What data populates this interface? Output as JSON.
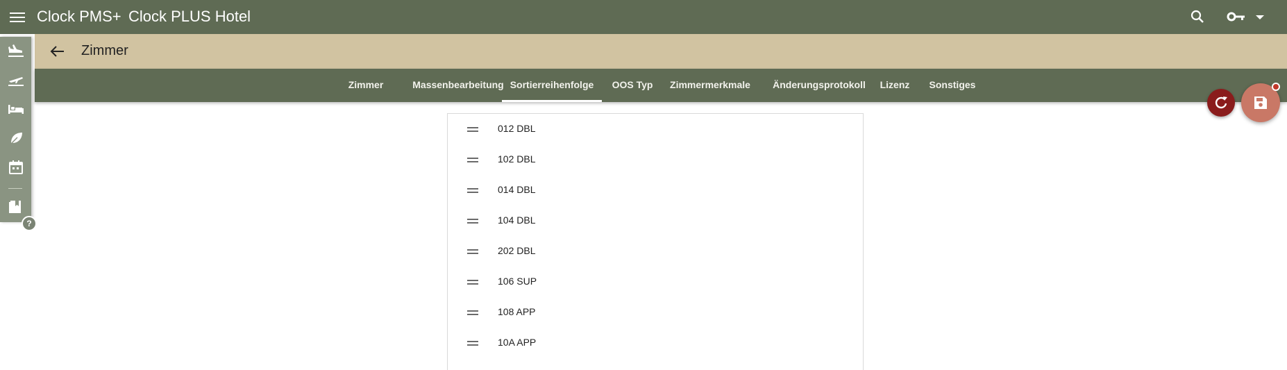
{
  "topbar": {
    "app_title": "Clock PMS+",
    "hotel_title": "Clock PLUS Hotel"
  },
  "subbar": {
    "page_title": "Zimmer"
  },
  "tabs": [
    {
      "label": "Zimmer",
      "active": false
    },
    {
      "label": "Massenbearbeitung",
      "active": false
    },
    {
      "label": "Sortierreihenfolge",
      "active": true
    },
    {
      "label": "OOS Typ",
      "active": false
    },
    {
      "label": "Zimmermerkmale",
      "active": false
    },
    {
      "label": "Änderungsprotokoll",
      "active": false
    },
    {
      "label": "Lizenz",
      "active": false
    },
    {
      "label": "Sonstiges",
      "active": false
    }
  ],
  "sidebar": {
    "icons": [
      "arrival-icon",
      "departure-icon",
      "bed-icon",
      "leaf-icon",
      "calendar-icon",
      "book-icon"
    ],
    "help_label": "?"
  },
  "rooms": [
    "012 DBL",
    "102 DBL",
    "014 DBL",
    "104 DBL",
    "202 DBL",
    "106 SUP",
    "108 APP",
    "10A APP"
  ],
  "colors": {
    "topbar": "#5f6b54",
    "subbar": "#d1c3a1",
    "reset_button": "#8a1c1c",
    "save_button": "#c97866"
  }
}
